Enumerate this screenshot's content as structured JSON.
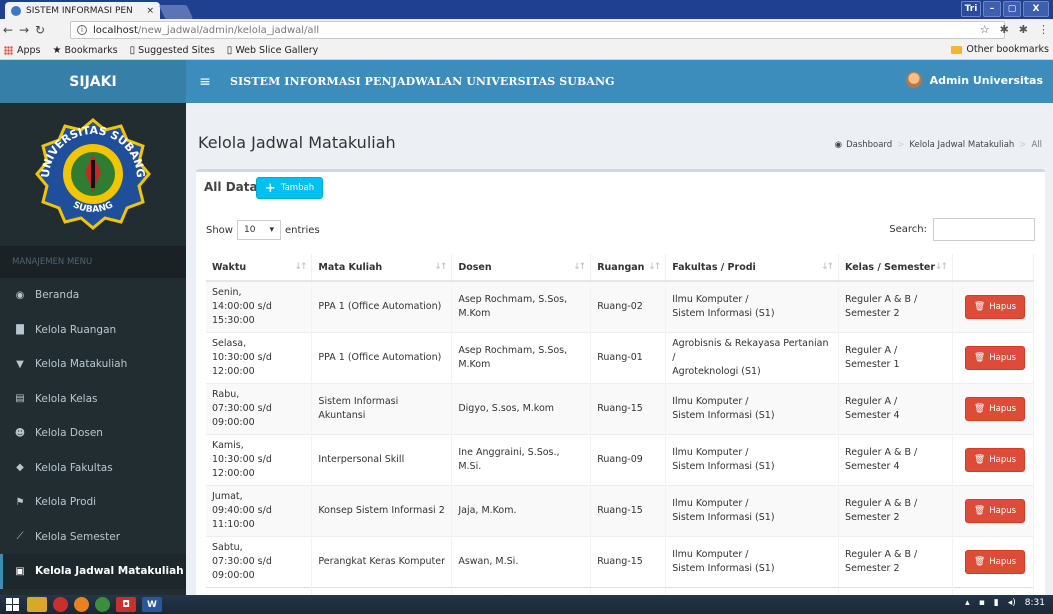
{
  "browser": {
    "tab_title": "SISTEM INFORMASI PEN",
    "tab_close": "×",
    "user_initials": "Tri",
    "win_min": "–",
    "win_max": "▢",
    "win_close": "X",
    "url_host": "localhost",
    "url_path": "/new_jadwal/admin/kelola_jadwal/all",
    "bookmarks": [
      "Apps",
      "Bookmarks",
      "Suggested Sites",
      "Web Slice Gallery"
    ],
    "other_bookmarks": "Other bookmarks"
  },
  "app": {
    "brand": "SIJAKI",
    "system_name": "SISTEM INFORMASI PENJADWALAN UNIVERSITAS SUBANG",
    "user_name": "Admin Universitas",
    "seal_top": "UNIVERSITAS SUBANG",
    "seal_bottom": "SUBANG"
  },
  "sidebar": {
    "header": "MANAJEMEN MENU",
    "items": [
      {
        "label": "Beranda",
        "icon": "dashboard-icon"
      },
      {
        "label": "Kelola Ruangan",
        "icon": "building-icon"
      },
      {
        "label": "Kelola Matakuliah",
        "icon": "bookmark-icon"
      },
      {
        "label": "Kelola Kelas",
        "icon": "file-icon"
      },
      {
        "label": "Kelola Dosen",
        "icon": "users-icon"
      },
      {
        "label": "Kelola Fakultas",
        "icon": "graduation-cap-icon"
      },
      {
        "label": "Kelola Prodi",
        "icon": "flag-icon"
      },
      {
        "label": "Kelola Semester",
        "icon": "line-chart-icon"
      },
      {
        "label": "Kelola Jadwal Matakuliah",
        "icon": "calendar-icon"
      }
    ]
  },
  "page": {
    "title": "Kelola Jadwal Matakuliah",
    "breadcrumb": [
      "Dashboard",
      "Kelola Jadwal Matakuliah",
      "All"
    ]
  },
  "box": {
    "title": "All Data",
    "add_button": "Tambah",
    "show_label": "Show",
    "entries_value": "10",
    "entries_label": "entries",
    "search_label": "Search:"
  },
  "table": {
    "headers": [
      "Waktu",
      "Mata Kuliah",
      "Dosen",
      "Ruangan",
      "Fakultas / Prodi",
      "Kelas / Semester"
    ],
    "delete_label": "Hapus",
    "rows": [
      {
        "waktu1": "Senin,",
        "waktu2": "14:00:00 s/d 15:30:00",
        "mk": "PPA 1 (Office Automation)",
        "dosen1": "Asep Rochmam, S.Sos,",
        "dosen2": "M.Kom",
        "ruang": "Ruang-02",
        "fak1": "Ilmu Komputer /",
        "fak2": "Sistem Informasi (S1)",
        "kelas1": "Reguler A & B /",
        "kelas2": "Semester 2"
      },
      {
        "waktu1": "Selasa,",
        "waktu2": "10:30:00 s/d 12:00:00",
        "mk": "PPA 1 (Office Automation)",
        "dosen1": "Asep Rochmam, S.Sos,",
        "dosen2": "M.Kom",
        "ruang": "Ruang-01",
        "fak1": "Agrobisnis & Rekayasa Pertanian /",
        "fak2": "Agroteknologi (S1)",
        "kelas1": "Reguler A /",
        "kelas2": "Semester 1"
      },
      {
        "waktu1": "Rabu,",
        "waktu2": "07:30:00 s/d 09:00:00",
        "mk": "Sistem Informasi Akuntansi",
        "dosen1": "Digyo, S.sos, M.kom",
        "dosen2": "",
        "ruang": "Ruang-15",
        "fak1": "Ilmu Komputer /",
        "fak2": "Sistem Informasi (S1)",
        "kelas1": "Reguler A /",
        "kelas2": "Semester 4"
      },
      {
        "waktu1": "Kamis,",
        "waktu2": "10:30:00 s/d 12:00:00",
        "mk": "Interpersonal Skill",
        "dosen1": "Ine Anggraini, S.Sos., M.Si.",
        "dosen2": "",
        "ruang": "Ruang-09",
        "fak1": "Ilmu Komputer /",
        "fak2": "Sistem Informasi (S1)",
        "kelas1": "Reguler A & B /",
        "kelas2": "Semester 4"
      },
      {
        "waktu1": "Jumat,",
        "waktu2": "09:40:00 s/d 11:10:00",
        "mk": "Konsep Sistem Informasi 2",
        "dosen1": "Jaja, M.Kom.",
        "dosen2": "",
        "ruang": "Ruang-15",
        "fak1": "Ilmu Komputer /",
        "fak2": "Sistem Informasi (S1)",
        "kelas1": "Reguler A & B /",
        "kelas2": "Semester 2"
      },
      {
        "waktu1": "Sabtu,",
        "waktu2": "07:30:00 s/d 09:00:00",
        "mk": "Perangkat Keras Komputer",
        "dosen1": "Aswan, M.Si.",
        "dosen2": "",
        "ruang": "Ruang-15",
        "fak1": "Ilmu Komputer /",
        "fak2": "Sistem Informasi (S1)",
        "kelas1": "Reguler A & B /",
        "kelas2": "Semester 2"
      }
    ]
  },
  "taskbar": {
    "time": "8:31"
  },
  "colors": {
    "header": "#3c8dbc",
    "header_dark": "#367fa9",
    "sidebar": "#222d32",
    "add_button": "#00c0ef",
    "delete_button": "#dd4b39"
  }
}
